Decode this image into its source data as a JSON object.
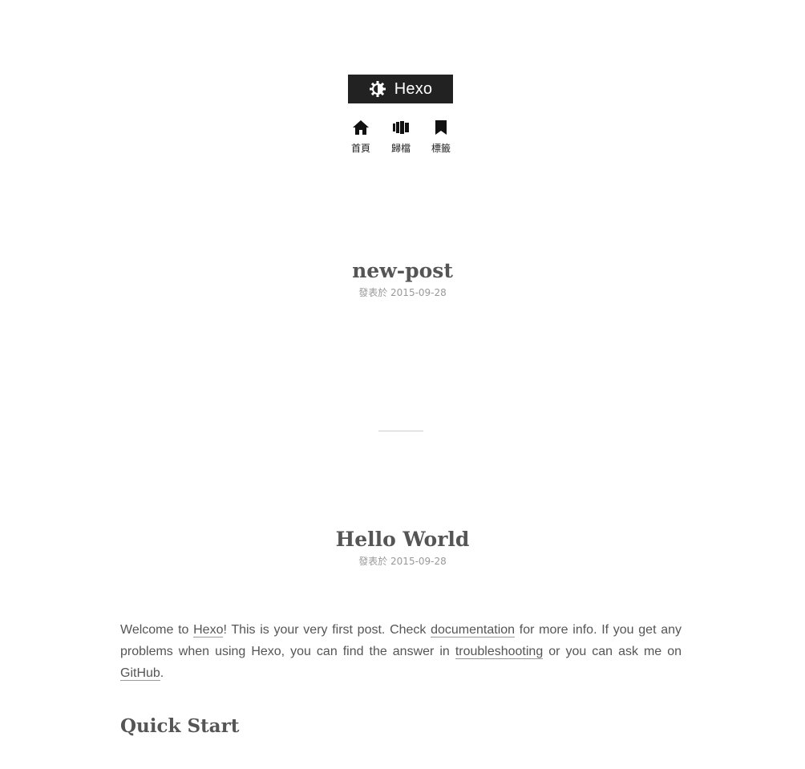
{
  "site": {
    "title": "Hexo",
    "logo_icon": "gear-logo-icon"
  },
  "menu": {
    "items": [
      {
        "label": "首頁",
        "icon": "home-icon"
      },
      {
        "label": "歸檔",
        "icon": "archive-icon"
      },
      {
        "label": "標籤",
        "icon": "bookmark-icon"
      }
    ]
  },
  "posts": [
    {
      "title": "new-post",
      "meta": "發表於 2015-09-28"
    },
    {
      "title": "Hello World",
      "meta": "發表於 2015-09-28",
      "body": {
        "t1": "Welcome to ",
        "link_hexo": "Hexo",
        "t2": "! This is your very first post. Check ",
        "link_docs": "documentation",
        "t3": " for more info. If you get any problems when using Hexo, you can find the answer in ",
        "link_trouble": "troubleshooting",
        "t4": " or you can ask me on ",
        "link_github": "GitHub",
        "t5": "."
      },
      "section_heading": "Quick Start"
    }
  ],
  "colors": {
    "logo_bg": "#222222",
    "text": "#555555",
    "meta": "#999999"
  }
}
